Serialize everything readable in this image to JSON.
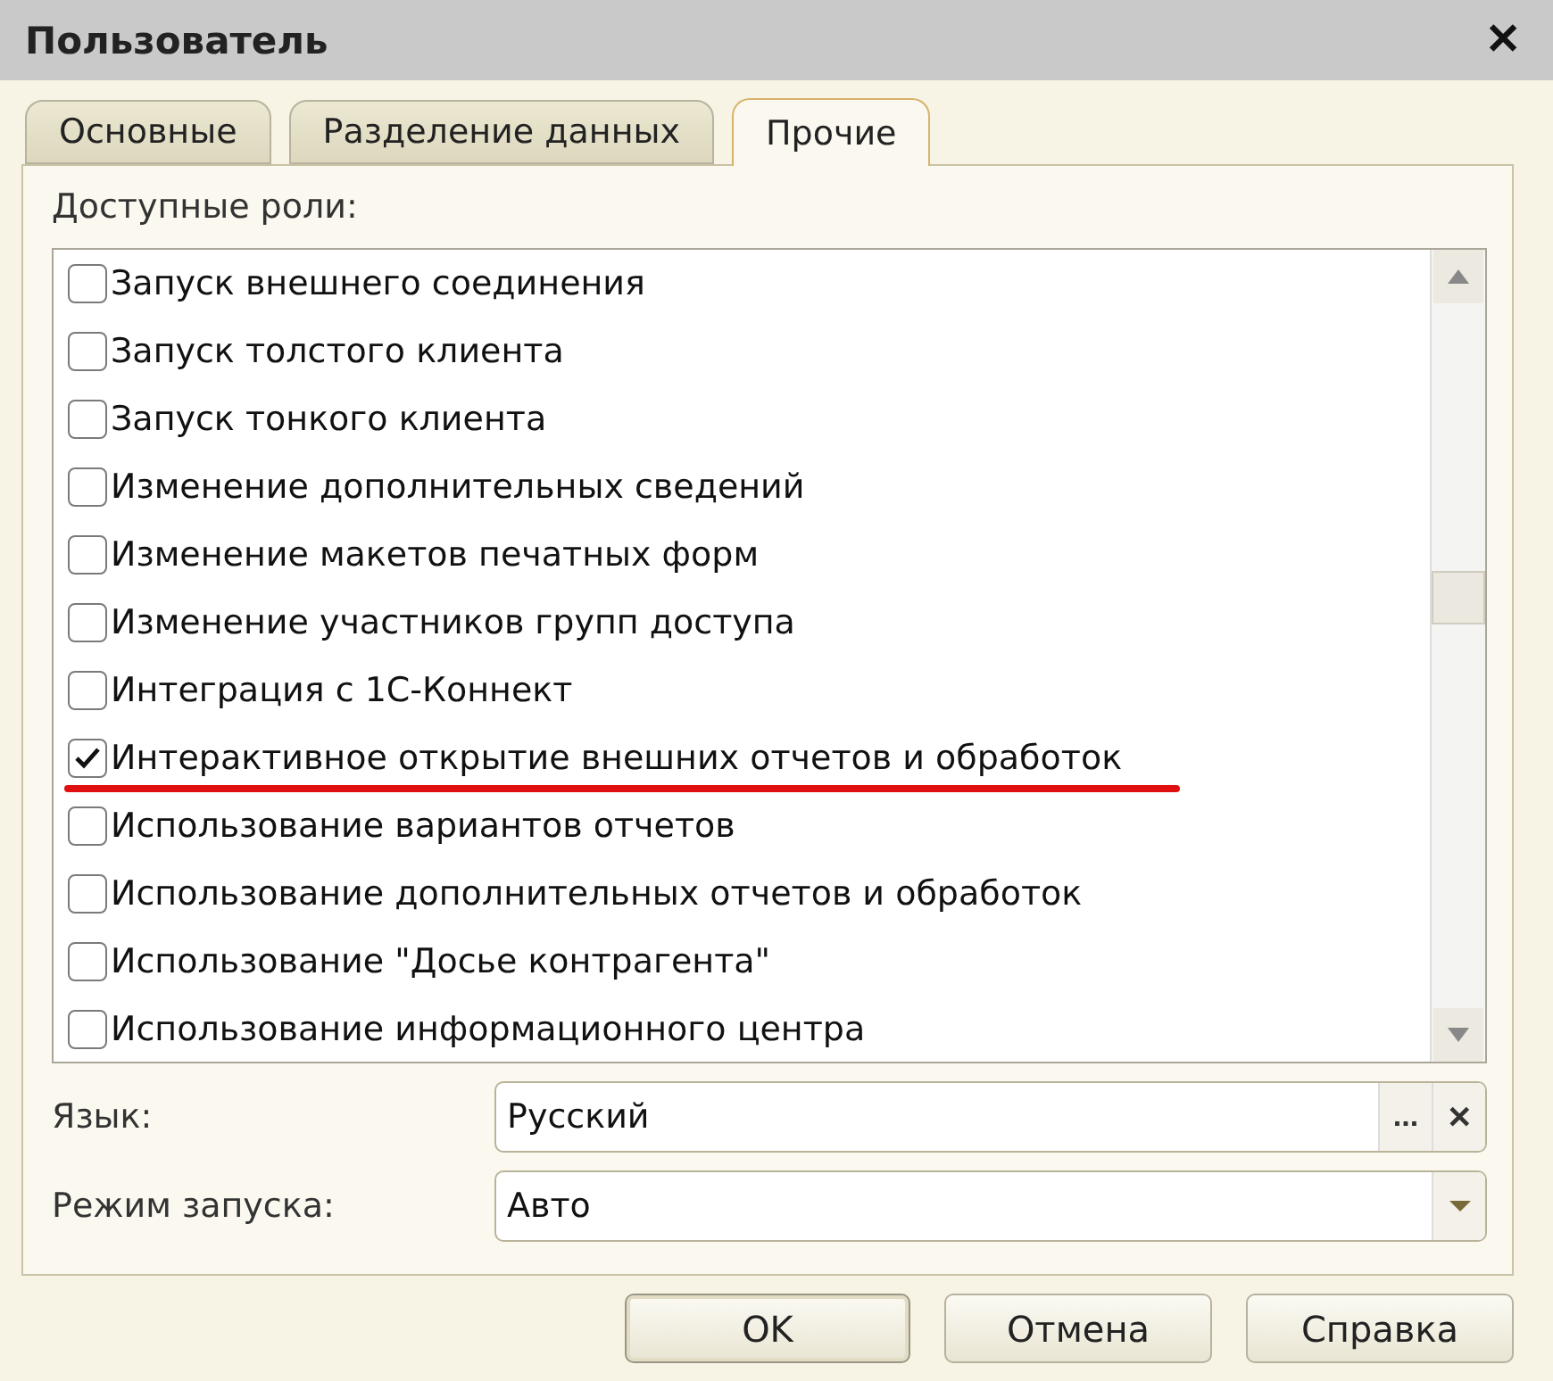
{
  "window": {
    "title": "Пользователь",
    "close": "✕"
  },
  "tabs": [
    {
      "label": "Основные",
      "selected": false
    },
    {
      "label": "Разделение данных",
      "selected": false
    },
    {
      "label": "Прочие",
      "selected": true
    }
  ],
  "roles_label": "Доступные роли:",
  "roles": [
    {
      "label": "Запуск внешнего соединения",
      "checked": false,
      "underlined": false
    },
    {
      "label": "Запуск толстого клиента",
      "checked": false,
      "underlined": false
    },
    {
      "label": "Запуск тонкого клиента",
      "checked": false,
      "underlined": false
    },
    {
      "label": "Изменение дополнительных сведений",
      "checked": false,
      "underlined": false
    },
    {
      "label": "Изменение макетов печатных форм",
      "checked": false,
      "underlined": false
    },
    {
      "label": "Изменение участников групп доступа",
      "checked": false,
      "underlined": false
    },
    {
      "label": "Интеграция с 1С-Коннект",
      "checked": false,
      "underlined": false
    },
    {
      "label": "Интерактивное открытие внешних отчетов и обработок",
      "checked": true,
      "underlined": true
    },
    {
      "label": "Использование вариантов отчетов",
      "checked": false,
      "underlined": false
    },
    {
      "label": "Использование дополнительных отчетов и обработок",
      "checked": false,
      "underlined": false
    },
    {
      "label": "Использование \"Досье контрагента\"",
      "checked": false,
      "underlined": false
    },
    {
      "label": "Использование информационного центра",
      "checked": false,
      "underlined": false
    }
  ],
  "fields": [
    {
      "kind": "choice",
      "label": "Язык:",
      "value": "Русский",
      "select_button": "...",
      "clear_button": "✕"
    },
    {
      "kind": "dropdown",
      "label": "Режим запуска:",
      "value": "Авто"
    }
  ],
  "buttons": [
    {
      "label": "OK",
      "default": true
    },
    {
      "label": "Отмена",
      "default": false
    },
    {
      "label": "Справка",
      "default": false
    }
  ]
}
